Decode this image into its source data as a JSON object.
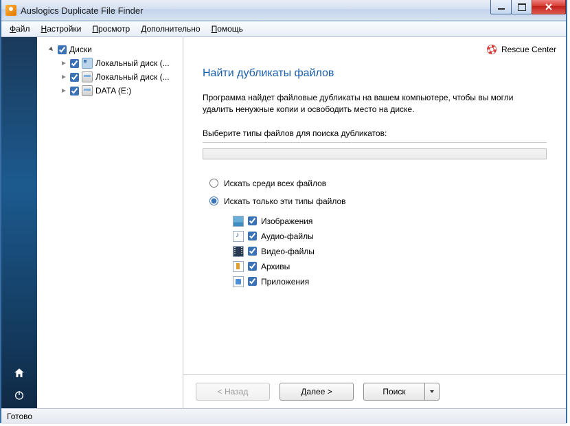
{
  "window": {
    "title": "Auslogics Duplicate File Finder"
  },
  "menu": {
    "items": [
      "Файл",
      "Настройки",
      "Просмотр",
      "Дополнительно",
      "Помощь"
    ]
  },
  "tree": {
    "root": "Диски",
    "nodes": [
      {
        "label": "Локальный диск (...",
        "iconType": "generic"
      },
      {
        "label": "Локальный диск (...",
        "iconType": "local"
      },
      {
        "label": "DATA (E:)",
        "iconType": "local"
      }
    ]
  },
  "rescue": {
    "label": "Rescue Center"
  },
  "main": {
    "heading": "Найти дубликаты файлов",
    "description": "Программа найдет файловые дубликаты на вашем компьютере, чтобы вы могли удалить ненужные копии и освободить место на диске.",
    "section_label": "Выберите типы файлов для поиска дубликатов:",
    "radio_all": "Искать среди всех файлов",
    "radio_types": "Искать только эти типы файлов",
    "filetypes": [
      {
        "label": "Изображения",
        "icon": "img"
      },
      {
        "label": "Аудио-файлы",
        "icon": "audio"
      },
      {
        "label": "Видео-файлы",
        "icon": "video"
      },
      {
        "label": "Архивы",
        "icon": "archive"
      },
      {
        "label": "Приложения",
        "icon": "app"
      }
    ]
  },
  "buttons": {
    "back": "< Назад",
    "next": "Далее >",
    "search": "Поиск"
  },
  "status": {
    "text": "Готово"
  }
}
